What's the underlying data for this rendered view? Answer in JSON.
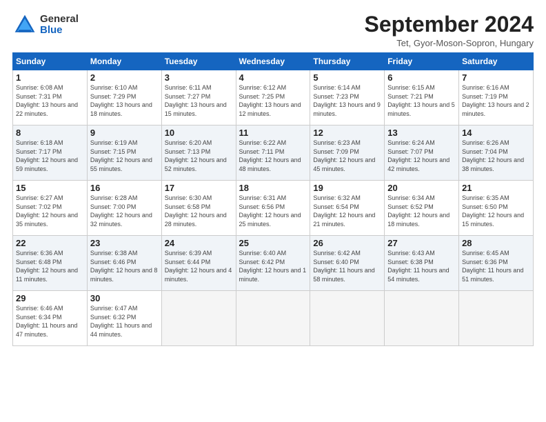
{
  "logo": {
    "general": "General",
    "blue": "Blue"
  },
  "title": "September 2024",
  "location": "Tet, Gyor-Moson-Sopron, Hungary",
  "days_of_week": [
    "Sunday",
    "Monday",
    "Tuesday",
    "Wednesday",
    "Thursday",
    "Friday",
    "Saturday"
  ],
  "weeks": [
    [
      {
        "day": "1",
        "sunrise": "Sunrise: 6:08 AM",
        "sunset": "Sunset: 7:31 PM",
        "daylight": "Daylight: 13 hours and 22 minutes."
      },
      {
        "day": "2",
        "sunrise": "Sunrise: 6:10 AM",
        "sunset": "Sunset: 7:29 PM",
        "daylight": "Daylight: 13 hours and 18 minutes."
      },
      {
        "day": "3",
        "sunrise": "Sunrise: 6:11 AM",
        "sunset": "Sunset: 7:27 PM",
        "daylight": "Daylight: 13 hours and 15 minutes."
      },
      {
        "day": "4",
        "sunrise": "Sunrise: 6:12 AM",
        "sunset": "Sunset: 7:25 PM",
        "daylight": "Daylight: 13 hours and 12 minutes."
      },
      {
        "day": "5",
        "sunrise": "Sunrise: 6:14 AM",
        "sunset": "Sunset: 7:23 PM",
        "daylight": "Daylight: 13 hours and 9 minutes."
      },
      {
        "day": "6",
        "sunrise": "Sunrise: 6:15 AM",
        "sunset": "Sunset: 7:21 PM",
        "daylight": "Daylight: 13 hours and 5 minutes."
      },
      {
        "day": "7",
        "sunrise": "Sunrise: 6:16 AM",
        "sunset": "Sunset: 7:19 PM",
        "daylight": "Daylight: 13 hours and 2 minutes."
      }
    ],
    [
      {
        "day": "8",
        "sunrise": "Sunrise: 6:18 AM",
        "sunset": "Sunset: 7:17 PM",
        "daylight": "Daylight: 12 hours and 59 minutes."
      },
      {
        "day": "9",
        "sunrise": "Sunrise: 6:19 AM",
        "sunset": "Sunset: 7:15 PM",
        "daylight": "Daylight: 12 hours and 55 minutes."
      },
      {
        "day": "10",
        "sunrise": "Sunrise: 6:20 AM",
        "sunset": "Sunset: 7:13 PM",
        "daylight": "Daylight: 12 hours and 52 minutes."
      },
      {
        "day": "11",
        "sunrise": "Sunrise: 6:22 AM",
        "sunset": "Sunset: 7:11 PM",
        "daylight": "Daylight: 12 hours and 48 minutes."
      },
      {
        "day": "12",
        "sunrise": "Sunrise: 6:23 AM",
        "sunset": "Sunset: 7:09 PM",
        "daylight": "Daylight: 12 hours and 45 minutes."
      },
      {
        "day": "13",
        "sunrise": "Sunrise: 6:24 AM",
        "sunset": "Sunset: 7:07 PM",
        "daylight": "Daylight: 12 hours and 42 minutes."
      },
      {
        "day": "14",
        "sunrise": "Sunrise: 6:26 AM",
        "sunset": "Sunset: 7:04 PM",
        "daylight": "Daylight: 12 hours and 38 minutes."
      }
    ],
    [
      {
        "day": "15",
        "sunrise": "Sunrise: 6:27 AM",
        "sunset": "Sunset: 7:02 PM",
        "daylight": "Daylight: 12 hours and 35 minutes."
      },
      {
        "day": "16",
        "sunrise": "Sunrise: 6:28 AM",
        "sunset": "Sunset: 7:00 PM",
        "daylight": "Daylight: 12 hours and 32 minutes."
      },
      {
        "day": "17",
        "sunrise": "Sunrise: 6:30 AM",
        "sunset": "Sunset: 6:58 PM",
        "daylight": "Daylight: 12 hours and 28 minutes."
      },
      {
        "day": "18",
        "sunrise": "Sunrise: 6:31 AM",
        "sunset": "Sunset: 6:56 PM",
        "daylight": "Daylight: 12 hours and 25 minutes."
      },
      {
        "day": "19",
        "sunrise": "Sunrise: 6:32 AM",
        "sunset": "Sunset: 6:54 PM",
        "daylight": "Daylight: 12 hours and 21 minutes."
      },
      {
        "day": "20",
        "sunrise": "Sunrise: 6:34 AM",
        "sunset": "Sunset: 6:52 PM",
        "daylight": "Daylight: 12 hours and 18 minutes."
      },
      {
        "day": "21",
        "sunrise": "Sunrise: 6:35 AM",
        "sunset": "Sunset: 6:50 PM",
        "daylight": "Daylight: 12 hours and 15 minutes."
      }
    ],
    [
      {
        "day": "22",
        "sunrise": "Sunrise: 6:36 AM",
        "sunset": "Sunset: 6:48 PM",
        "daylight": "Daylight: 12 hours and 11 minutes."
      },
      {
        "day": "23",
        "sunrise": "Sunrise: 6:38 AM",
        "sunset": "Sunset: 6:46 PM",
        "daylight": "Daylight: 12 hours and 8 minutes."
      },
      {
        "day": "24",
        "sunrise": "Sunrise: 6:39 AM",
        "sunset": "Sunset: 6:44 PM",
        "daylight": "Daylight: 12 hours and 4 minutes."
      },
      {
        "day": "25",
        "sunrise": "Sunrise: 6:40 AM",
        "sunset": "Sunset: 6:42 PM",
        "daylight": "Daylight: 12 hours and 1 minute."
      },
      {
        "day": "26",
        "sunrise": "Sunrise: 6:42 AM",
        "sunset": "Sunset: 6:40 PM",
        "daylight": "Daylight: 11 hours and 58 minutes."
      },
      {
        "day": "27",
        "sunrise": "Sunrise: 6:43 AM",
        "sunset": "Sunset: 6:38 PM",
        "daylight": "Daylight: 11 hours and 54 minutes."
      },
      {
        "day": "28",
        "sunrise": "Sunrise: 6:45 AM",
        "sunset": "Sunset: 6:36 PM",
        "daylight": "Daylight: 11 hours and 51 minutes."
      }
    ],
    [
      {
        "day": "29",
        "sunrise": "Sunrise: 6:46 AM",
        "sunset": "Sunset: 6:34 PM",
        "daylight": "Daylight: 11 hours and 47 minutes."
      },
      {
        "day": "30",
        "sunrise": "Sunrise: 6:47 AM",
        "sunset": "Sunset: 6:32 PM",
        "daylight": "Daylight: 11 hours and 44 minutes."
      },
      null,
      null,
      null,
      null,
      null
    ]
  ]
}
